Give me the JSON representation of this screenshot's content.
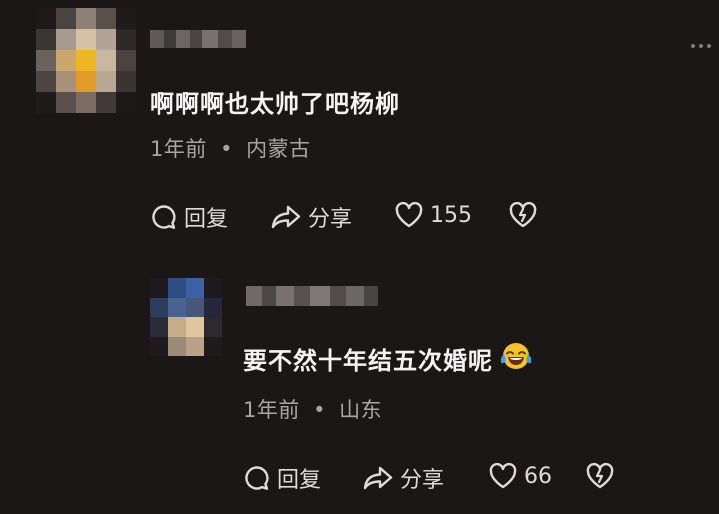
{
  "comments": [
    {
      "text": "啊啊啊也太帅了吧杨柳",
      "time": "1年前",
      "location": "内蒙古",
      "actions": {
        "reply": "回复",
        "share": "分享",
        "likes": "155"
      }
    }
  ],
  "reply": {
    "text": "要不然十年结五次婚呢",
    "emoji": "laughing-crying-emoji",
    "time": "1年前",
    "location": "山东",
    "actions": {
      "reply": "回复",
      "share": "分享",
      "likes": "66"
    }
  },
  "separator": "•",
  "colors": {
    "background": "#1b1717",
    "text": "#f3f3f3",
    "meta": "#a6a6a6",
    "emoji": "#3aa0f0"
  }
}
